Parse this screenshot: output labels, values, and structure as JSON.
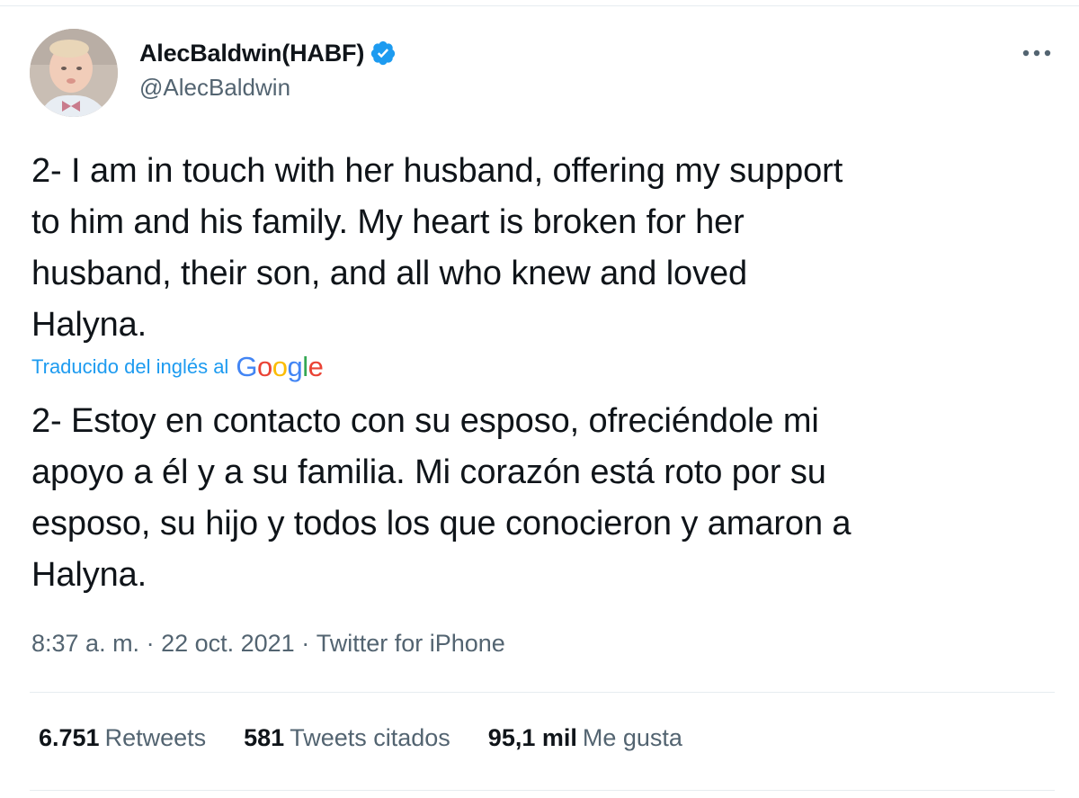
{
  "author": {
    "display_name": "AlecBaldwin(HABF)",
    "handle": "@AlecBaldwin",
    "verified": true,
    "avatar_icon": "avatar-photo-child"
  },
  "menu": {
    "more_icon": "more-horizontal-icon"
  },
  "tweet": {
    "text": "2- I am in touch with her husband, offering my support\nto him and his family. My heart is broken for her\nhusband, their son, and all who knew and loved\nHalyna.",
    "translation_label": "Traducido del inglés al",
    "translation_provider": "Google",
    "translated_text": "2- Estoy en contacto con su esposo, ofreciéndole mi\napoyo a él y a su familia. Mi corazón está roto por su\nesposo, su hijo y todos los que conocieron y amaron a\nHalyna."
  },
  "meta": {
    "time": "8:37 a. m.",
    "separator": " · ",
    "date": "22 oct. 2021",
    "source": "Twitter for iPhone"
  },
  "stats": {
    "retweets_count": "6.751",
    "retweets_label": "Retweets",
    "quotes_count": "581",
    "quotes_label": "Tweets citados",
    "likes_count": "95,1 mil",
    "likes_label": "Me gusta"
  },
  "colors": {
    "accent": "#1d9bf0",
    "text": "#0f1419",
    "secondary": "#536471",
    "divider": "#e6ecf0"
  }
}
